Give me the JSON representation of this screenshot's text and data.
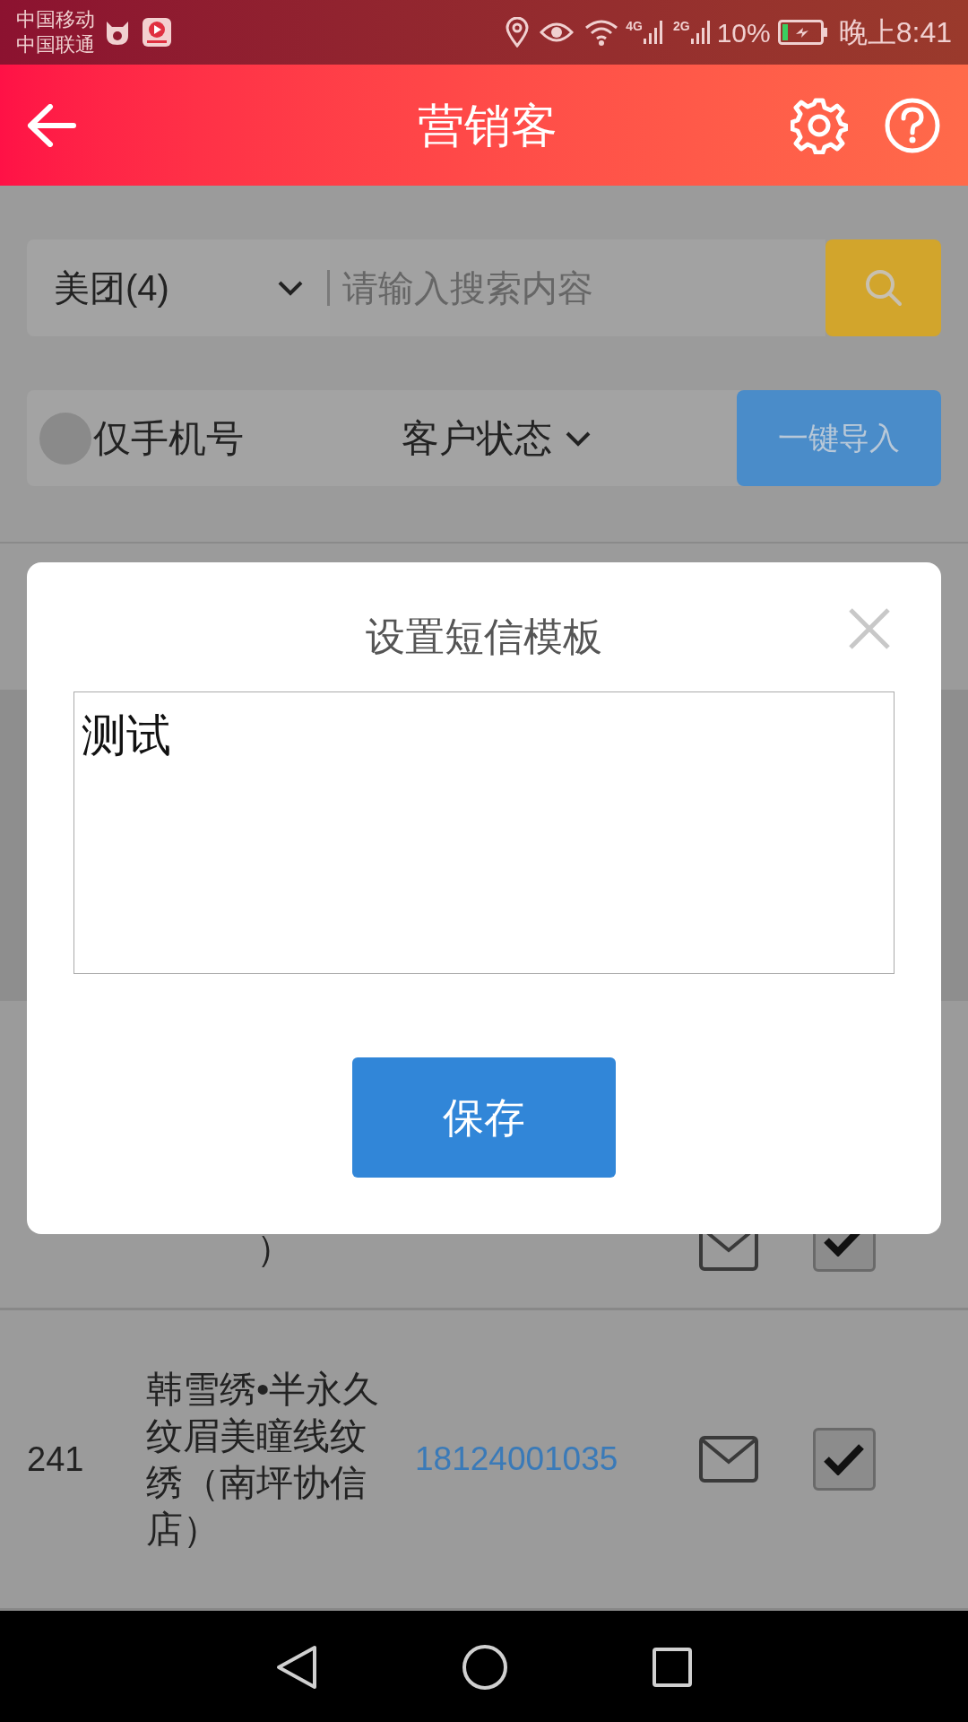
{
  "status_bar": {
    "carriers": [
      "中国移动",
      "中国联通"
    ],
    "network_labels": [
      "4G",
      "2G"
    ],
    "battery": "10%",
    "time": "晚上8:41"
  },
  "header": {
    "title": "营销客"
  },
  "search": {
    "source": "美团(4)",
    "placeholder": "请输入搜索内容"
  },
  "filters": {
    "phone_only": {
      "label": "仅手机号",
      "checked": false
    },
    "status_label": "客户状态",
    "import_button": "一键导入"
  },
  "rows": [
    {
      "name": "）",
      "checked": true
    },
    {
      "number": "241",
      "name": "韩雪绣•半永久纹眉美瞳线纹绣（南坪协信店）",
      "phone": "18124001035",
      "checked": true
    }
  ],
  "dialog": {
    "title": "设置短信模板",
    "message": "测试",
    "save_button": "保存"
  }
}
